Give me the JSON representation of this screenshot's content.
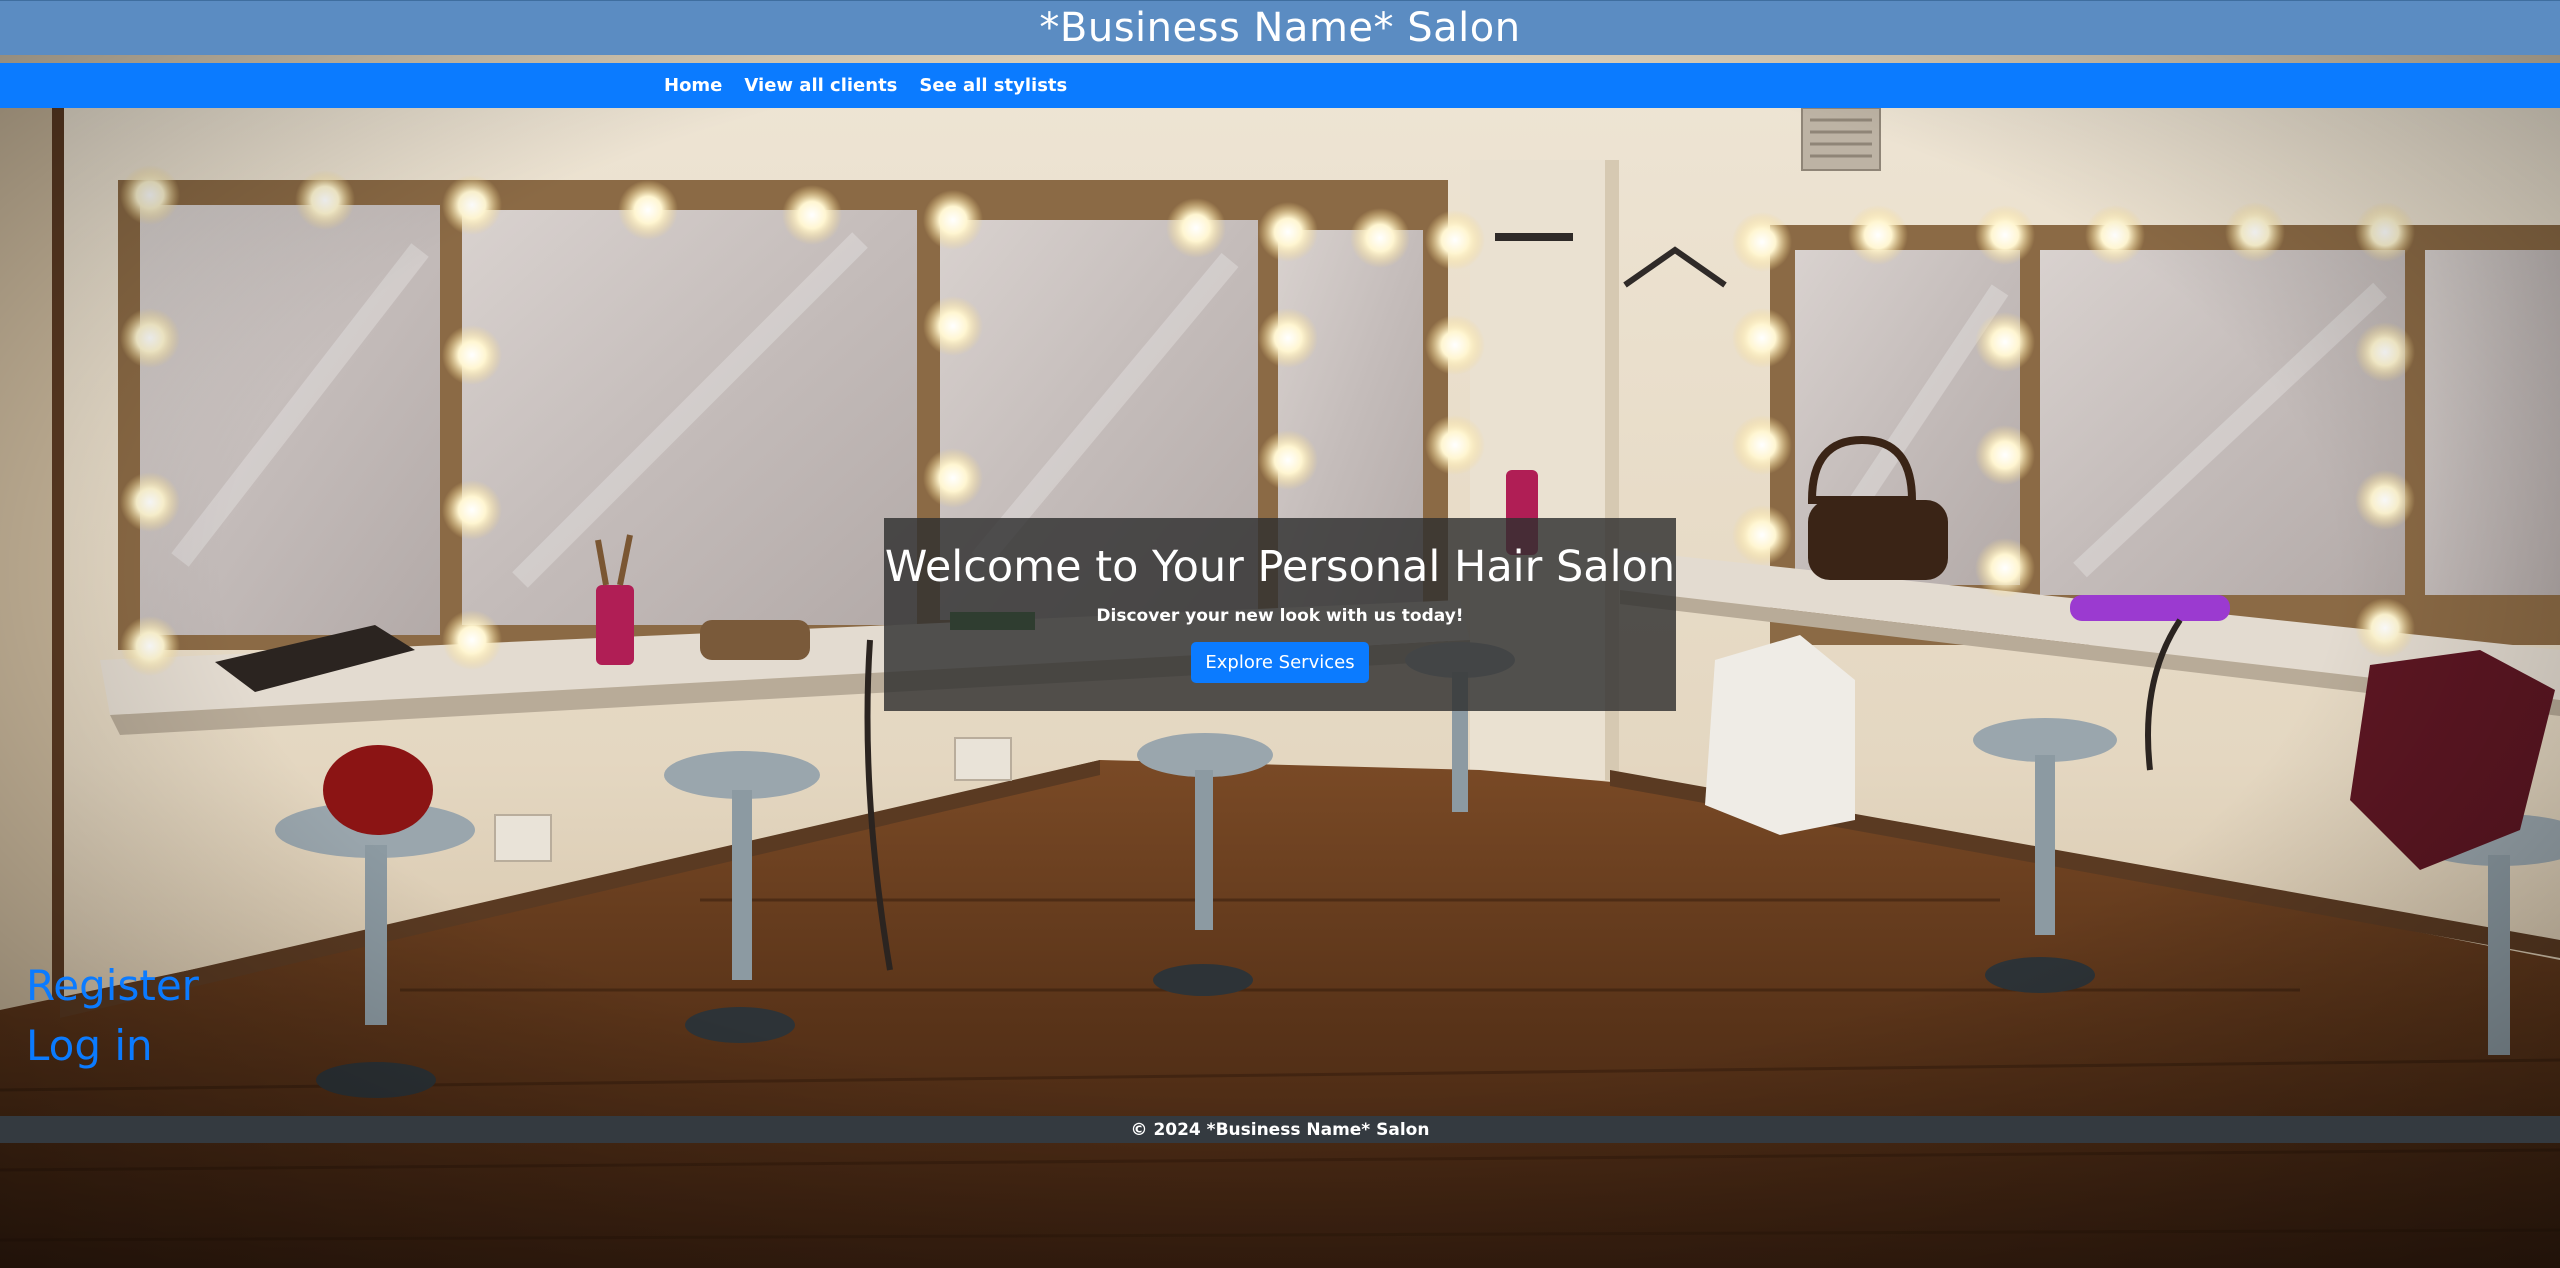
{
  "header": {
    "title": "*Business Name* Salon"
  },
  "nav": {
    "items": [
      {
        "label": "Home"
      },
      {
        "label": "View all clients"
      },
      {
        "label": "See all stylists"
      }
    ]
  },
  "hero": {
    "title": "Welcome to Your Personal Hair Salon",
    "subtitle": "Discover your new look with us today!",
    "button_label": "Explore Services"
  },
  "auth": {
    "register_label": "Register",
    "login_label": "Log in"
  },
  "footer": {
    "text": "© 2024 *Business Name* Salon"
  },
  "colors": {
    "header_bg": "#5b8cc2",
    "nav_bg": "#0b7bff",
    "link": "#0b7bff",
    "footer_bg": "#343a40",
    "hero_overlay": "#303030"
  },
  "background_image": "salon-dressing-room-illustration"
}
